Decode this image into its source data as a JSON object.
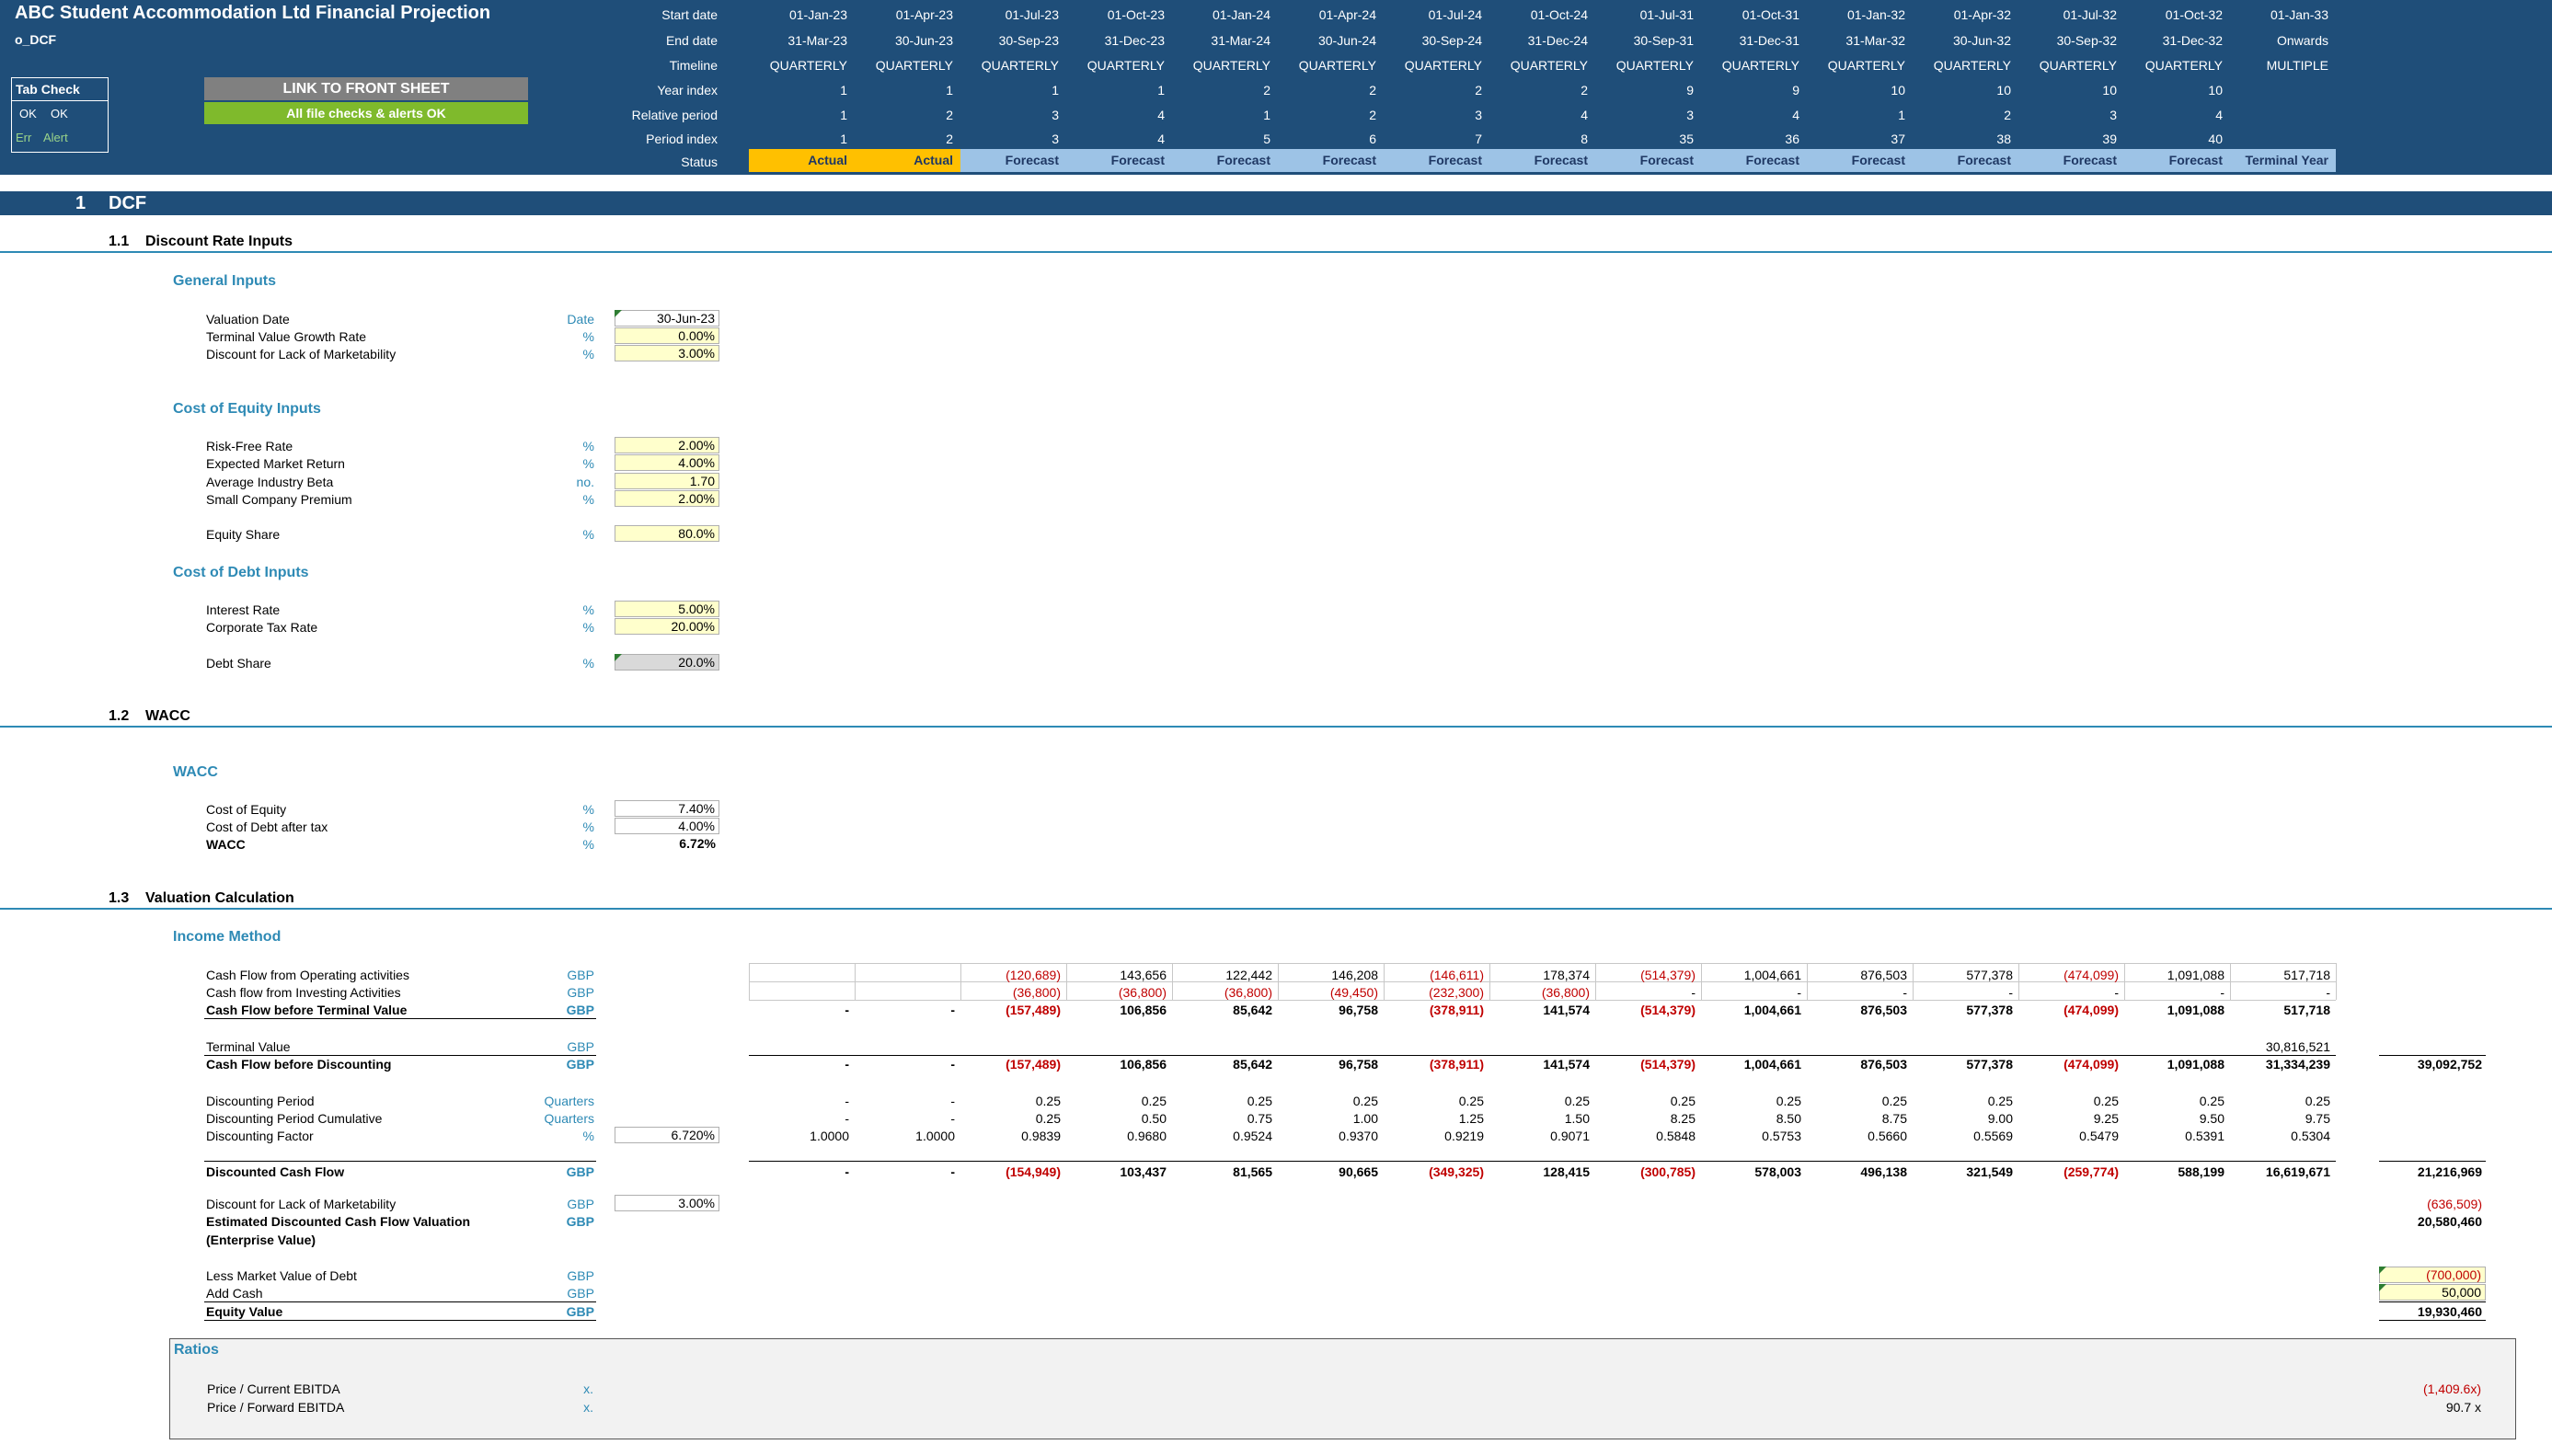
{
  "header": {
    "title": "ABC Student Accommodation Ltd Financial Projection",
    "sheet": "o_DCF",
    "row_labels": [
      "Start date",
      "End date",
      "Timeline",
      "Year index",
      "Relative period",
      "Period index",
      "Status"
    ],
    "tabcheck_title": "Tab Check",
    "tabcheck_ok": [
      "OK",
      "OK"
    ],
    "tabcheck_err": [
      "Err",
      "Alert"
    ],
    "link_button": "LINK TO FRONT SHEET",
    "checks_ok": "All file checks & alerts OK",
    "columns": [
      {
        "start": "01-Jan-23",
        "end": "31-Mar-23",
        "timeline": "QUARTERLY",
        "year": "1",
        "rel": "1",
        "period": "1",
        "status": "Actual"
      },
      {
        "start": "01-Apr-23",
        "end": "30-Jun-23",
        "timeline": "QUARTERLY",
        "year": "1",
        "rel": "2",
        "period": "2",
        "status": "Actual"
      },
      {
        "start": "01-Jul-23",
        "end": "30-Sep-23",
        "timeline": "QUARTERLY",
        "year": "1",
        "rel": "3",
        "period": "3",
        "status": "Forecast"
      },
      {
        "start": "01-Oct-23",
        "end": "31-Dec-23",
        "timeline": "QUARTERLY",
        "year": "1",
        "rel": "4",
        "period": "4",
        "status": "Forecast"
      },
      {
        "start": "01-Jan-24",
        "end": "31-Mar-24",
        "timeline": "QUARTERLY",
        "year": "2",
        "rel": "1",
        "period": "5",
        "status": "Forecast"
      },
      {
        "start": "01-Apr-24",
        "end": "30-Jun-24",
        "timeline": "QUARTERLY",
        "year": "2",
        "rel": "2",
        "period": "6",
        "status": "Forecast"
      },
      {
        "start": "01-Jul-24",
        "end": "30-Sep-24",
        "timeline": "QUARTERLY",
        "year": "2",
        "rel": "3",
        "period": "7",
        "status": "Forecast"
      },
      {
        "start": "01-Oct-24",
        "end": "31-Dec-24",
        "timeline": "QUARTERLY",
        "year": "2",
        "rel": "4",
        "period": "8",
        "status": "Forecast"
      },
      {
        "start": "01-Jul-31",
        "end": "30-Sep-31",
        "timeline": "QUARTERLY",
        "year": "9",
        "rel": "3",
        "period": "35",
        "status": "Forecast"
      },
      {
        "start": "01-Oct-31",
        "end": "31-Dec-31",
        "timeline": "QUARTERLY",
        "year": "9",
        "rel": "4",
        "period": "36",
        "status": "Forecast"
      },
      {
        "start": "01-Jan-32",
        "end": "31-Mar-32",
        "timeline": "QUARTERLY",
        "year": "10",
        "rel": "1",
        "period": "37",
        "status": "Forecast"
      },
      {
        "start": "01-Apr-32",
        "end": "30-Jun-32",
        "timeline": "QUARTERLY",
        "year": "10",
        "rel": "2",
        "period": "38",
        "status": "Forecast"
      },
      {
        "start": "01-Jul-32",
        "end": "30-Sep-32",
        "timeline": "QUARTERLY",
        "year": "10",
        "rel": "3",
        "period": "39",
        "status": "Forecast"
      },
      {
        "start": "01-Oct-32",
        "end": "31-Dec-32",
        "timeline": "QUARTERLY",
        "year": "10",
        "rel": "4",
        "period": "40",
        "status": "Forecast"
      },
      {
        "start": "01-Jan-33",
        "end": "Onwards",
        "timeline": "MULTIPLE",
        "year": "",
        "rel": "",
        "period": "",
        "status": "Terminal Year"
      }
    ]
  },
  "section": {
    "num": "1",
    "title": "DCF"
  },
  "subs": {
    "s11": {
      "num": "1.1",
      "title": "Discount Rate Inputs"
    },
    "s12": {
      "num": "1.2",
      "title": "WACC"
    },
    "s13": {
      "num": "1.3",
      "title": "Valuation Calculation"
    }
  },
  "general": {
    "title": "General Inputs",
    "rows": [
      {
        "label": "Valuation Date",
        "unit": "Date",
        "value": "30-Jun-23"
      },
      {
        "label": "Terminal Value Growth Rate",
        "unit": "%",
        "value": "0.00%"
      },
      {
        "label": "Discount for Lack of Marketability",
        "unit": "%",
        "value": "3.00%"
      }
    ]
  },
  "coe": {
    "title": "Cost of Equity Inputs",
    "rows": [
      {
        "label": "Risk-Free Rate",
        "unit": "%",
        "value": "2.00%"
      },
      {
        "label": "Expected Market Return",
        "unit": "%",
        "value": "4.00%"
      },
      {
        "label": "Average Industry Beta",
        "unit": "no.",
        "value": "1.70"
      },
      {
        "label": "Small Company Premium",
        "unit": "%",
        "value": "2.00%"
      }
    ],
    "equity_share": {
      "label": "Equity Share",
      "unit": "%",
      "value": "80.0%"
    }
  },
  "cod": {
    "title": "Cost of Debt Inputs",
    "rows": [
      {
        "label": "Interest Rate",
        "unit": "%",
        "value": "5.00%"
      },
      {
        "label": "Corporate Tax Rate",
        "unit": "%",
        "value": "20.00%"
      }
    ],
    "debt_share": {
      "label": "Debt Share",
      "unit": "%",
      "value": "20.0%"
    }
  },
  "wacc": {
    "title": "WACC",
    "rows": [
      {
        "label": "Cost of Equity",
        "unit": "%",
        "value": "7.40%"
      },
      {
        "label": "Cost of Debt after tax",
        "unit": "%",
        "value": "4.00%"
      },
      {
        "label": "WACC",
        "unit": "%",
        "value": "6.72%"
      }
    ]
  },
  "income": {
    "title": "Income Method",
    "rows": [
      {
        "label": "Cash Flow from Operating activities",
        "unit": "GBP",
        "total": "",
        "cells": [
          "",
          "",
          "(120,689)",
          "143,656",
          "122,442",
          "146,208",
          "(146,611)",
          "178,374",
          "(514,379)",
          "1,004,661",
          "876,503",
          "577,378",
          "(474,099)",
          "1,091,088",
          "517,718"
        ]
      },
      {
        "label": "Cash flow from Investing Activities",
        "unit": "GBP",
        "total": "",
        "cells": [
          "",
          "",
          "(36,800)",
          "(36,800)",
          "(36,800)",
          "(49,450)",
          "(232,300)",
          "(36,800)",
          "-",
          "-",
          "-",
          "-",
          "-",
          "-",
          "-"
        ]
      },
      {
        "label": "Cash Flow before Terminal Value",
        "unit": "GBP",
        "total": "",
        "cells": [
          "-",
          "-",
          "(157,489)",
          "106,856",
          "85,642",
          "96,758",
          "(378,911)",
          "141,574",
          "(514,379)",
          "1,004,661",
          "876,503",
          "577,378",
          "(474,099)",
          "1,091,088",
          "517,718"
        ]
      },
      {
        "label": "Terminal Value",
        "unit": "GBP",
        "total": "",
        "cells": [
          "",
          "",
          "",
          "",
          "",
          "",
          "",
          "",
          "",
          "",
          "",
          "",
          "",
          "",
          "30,816,521"
        ]
      },
      {
        "label": "Cash Flow before Discounting",
        "unit": "GBP",
        "total": "39,092,752",
        "cells": [
          "-",
          "-",
          "(157,489)",
          "106,856",
          "85,642",
          "96,758",
          "(378,911)",
          "141,574",
          "(514,379)",
          "1,004,661",
          "876,503",
          "577,378",
          "(474,099)",
          "1,091,088",
          "31,334,239"
        ]
      },
      {
        "label": "Discounting Period",
        "unit": "Quarters",
        "input": "",
        "total": "",
        "cells": [
          "-",
          "-",
          "0.25",
          "0.25",
          "0.25",
          "0.25",
          "0.25",
          "0.25",
          "0.25",
          "0.25",
          "0.25",
          "0.25",
          "0.25",
          "0.25",
          "0.25"
        ]
      },
      {
        "label": "Discounting Period Cumulative",
        "unit": "Quarters",
        "input": "",
        "total": "",
        "cells": [
          "-",
          "-",
          "0.25",
          "0.50",
          "0.75",
          "1.00",
          "1.25",
          "1.50",
          "8.25",
          "8.50",
          "8.75",
          "9.00",
          "9.25",
          "9.50",
          "9.75"
        ]
      },
      {
        "label": "Discounting Factor",
        "unit": "%",
        "input": "6.720%",
        "total": "",
        "cells": [
          "1.0000",
          "1.0000",
          "0.9839",
          "0.9680",
          "0.9524",
          "0.9370",
          "0.9219",
          "0.9071",
          "0.5848",
          "0.5753",
          "0.5660",
          "0.5569",
          "0.5479",
          "0.5391",
          "0.5304"
        ]
      },
      {
        "label": "Discounted Cash Flow",
        "unit": "GBP",
        "total": "21,216,969",
        "cells": [
          "-",
          "-",
          "(154,949)",
          "103,437",
          "81,565",
          "90,665",
          "(349,325)",
          "128,415",
          "(300,785)",
          "578,003",
          "496,138",
          "321,549",
          "(259,774)",
          "588,199",
          "16,619,671"
        ]
      }
    ],
    "dlom": {
      "label": "Discount for Lack of Marketability",
      "unit": "GBP",
      "input": "3.00%",
      "total": "(636,509)"
    },
    "edcf": {
      "label": "Estimated Discounted Cash Flow Valuation",
      "label2": "(Enterprise Value)",
      "unit": "GBP",
      "total": "20,580,460"
    },
    "debt": {
      "label": "Less Market Value of Debt",
      "unit": "GBP",
      "total": "(700,000)"
    },
    "cash": {
      "label": "Add Cash",
      "unit": "GBP",
      "total": "50,000"
    },
    "equity": {
      "label": "Equity Value",
      "unit": "GBP",
      "total": "19,930,460"
    }
  },
  "ratios": {
    "title": "Ratios",
    "rows": [
      {
        "label": "Price / Current EBITDA",
        "unit": "x.",
        "value": "(1,409.6x)"
      },
      {
        "label": "Price / Forward EBITDA",
        "unit": "x.",
        "value": "90.7 x"
      }
    ]
  }
}
